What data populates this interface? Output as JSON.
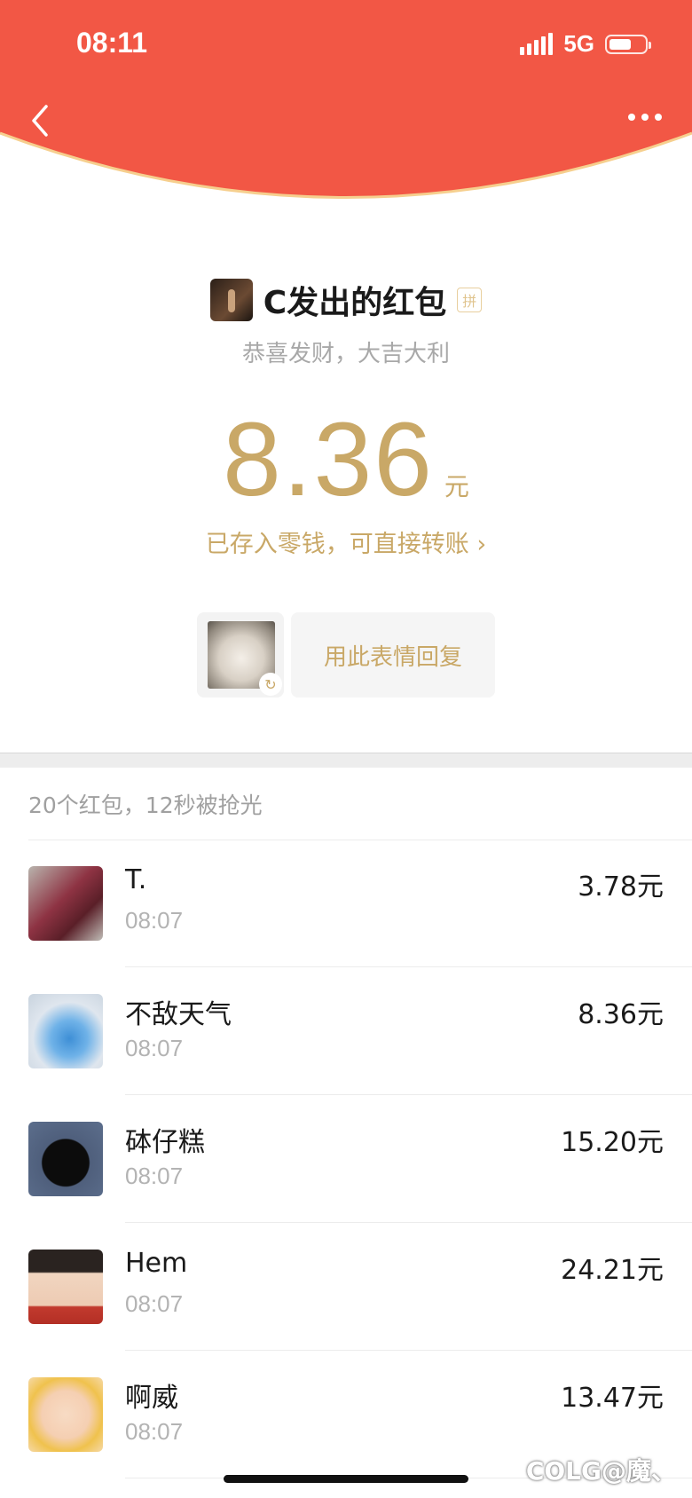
{
  "status_bar": {
    "time": "08:11",
    "network": "5G"
  },
  "colors": {
    "header_red": "#F25745",
    "gold": "#C9A867",
    "gold_rim": "#F6CF8E"
  },
  "sender": {
    "title": "C发出的红包",
    "badge": "拼"
  },
  "blessing": "恭喜发财，大吉大利",
  "amount": {
    "value": "8.36",
    "unit": "元"
  },
  "wallet_link": "已存入零钱，可直接转账 ›",
  "reply": {
    "button": "用此表情回复"
  },
  "summary": "20个红包，12秒被抢光",
  "records": [
    {
      "name": "T.",
      "time": "08:07",
      "amount": "3.78元"
    },
    {
      "name": "不敌天气",
      "time": "08:07",
      "amount": "8.36元"
    },
    {
      "name": "砵仔糕",
      "time": "08:07",
      "amount": "15.20元"
    },
    {
      "name": "Hem",
      "time": "08:07",
      "amount": "24.21元"
    },
    {
      "name": "啊威",
      "time": "08:07",
      "amount": "13.47元"
    }
  ],
  "watermark": "COLG@魔、"
}
